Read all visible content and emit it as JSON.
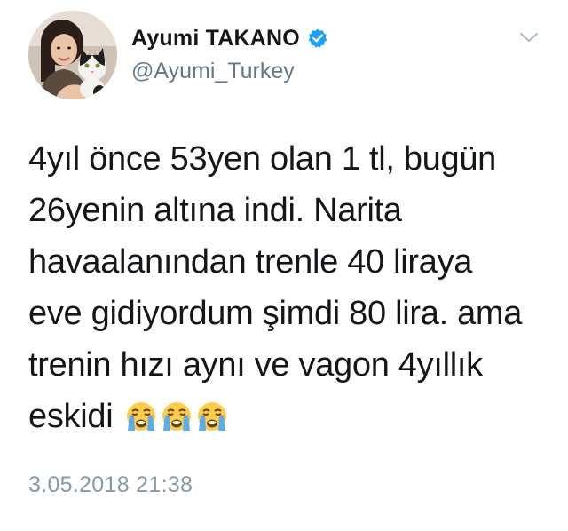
{
  "user": {
    "display_name": "Ayumi TAKANO",
    "handle": "@Ayumi_Turkey",
    "verified": true,
    "verified_color": "#1da1f2"
  },
  "tweet": {
    "text": "4yıl önce 53yen olan 1 tl, bugün\n26yenin altına indi. Narita\nhavaalanından trenle 40 liraya\neve gidiyordum şimdi 80 lira. ama\ntrenin hızı aynı ve vagon 4yıllık\neskidi",
    "emojis": [
      "loudly-crying-face",
      "loudly-crying-face",
      "loudly-crying-face"
    ],
    "timestamp": "3.05.2018 21:38"
  },
  "icons": {
    "menu": "chevron-down-icon",
    "badge": "verified-badge-icon"
  }
}
